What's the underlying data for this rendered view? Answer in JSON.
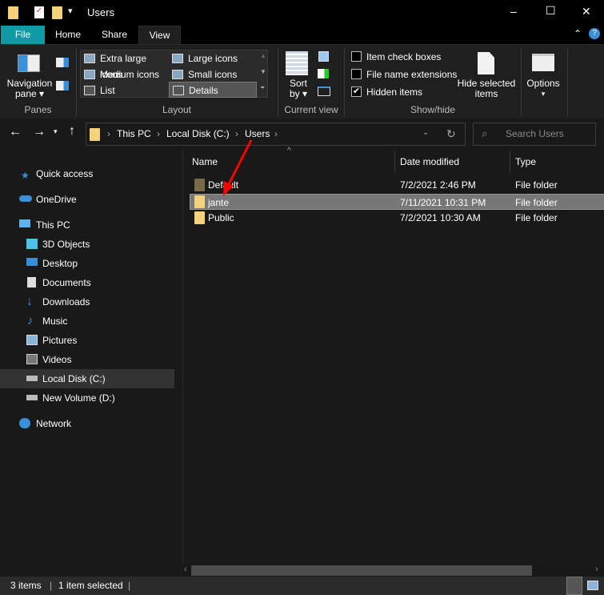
{
  "window": {
    "title": "Users",
    "minimize": "–",
    "maximize": "☐",
    "close": "✕"
  },
  "tabs": [
    {
      "label": "File"
    },
    {
      "label": "Home"
    },
    {
      "label": "Share"
    },
    {
      "label": "View"
    }
  ],
  "ribbon": {
    "panes": {
      "nav_pane": "Navigation",
      "nav_pane2": "pane ▾",
      "group": "Panes"
    },
    "layout": {
      "items": [
        "Extra large icons",
        "Large icons",
        "Medium icons",
        "Small icons",
        "List",
        "Details"
      ],
      "selected": "Details",
      "group": "Layout"
    },
    "current_view": {
      "sort": "Sort",
      "sort2": "by ▾",
      "group": "Current view"
    },
    "show_hide": {
      "item_check_boxes": {
        "label": "Item check boxes",
        "checked": false
      },
      "file_name_extensions": {
        "label": "File name extensions",
        "checked": false
      },
      "hidden_items": {
        "label": "Hidden items",
        "checked": true
      },
      "hide_selected": "Hide selected",
      "hide_selected2": "items",
      "group": "Show/hide"
    },
    "options": {
      "label": "Options",
      "caret": "▾"
    }
  },
  "address": {
    "crumbs": [
      "This PC",
      "Local Disk (C:)",
      "Users"
    ],
    "search_placeholder": "Search Users"
  },
  "sidebar": [
    {
      "label": "Quick access"
    },
    {
      "label": "OneDrive"
    },
    {
      "label": "This PC"
    },
    {
      "label": "3D Objects"
    },
    {
      "label": "Desktop"
    },
    {
      "label": "Documents"
    },
    {
      "label": "Downloads"
    },
    {
      "label": "Music"
    },
    {
      "label": "Pictures"
    },
    {
      "label": "Videos"
    },
    {
      "label": "Local Disk (C:)"
    },
    {
      "label": "New Volume (D:)"
    },
    {
      "label": "Network"
    }
  ],
  "columns": {
    "name": "Name",
    "date": "Date modified",
    "type": "Type"
  },
  "files": [
    {
      "name": "Default",
      "date": "7/2/2021 2:46 PM",
      "type": "File folder"
    },
    {
      "name": "jante",
      "date": "7/11/2021 10:31 PM",
      "type": "File folder"
    },
    {
      "name": "Public",
      "date": "7/2/2021 10:30 AM",
      "type": "File folder"
    }
  ],
  "status": {
    "count": "3 items",
    "selected": "1 item selected"
  },
  "colors": {
    "file_tab": "#0f9aa5",
    "selected_row": "#777777",
    "arrow": "#ff0000"
  }
}
